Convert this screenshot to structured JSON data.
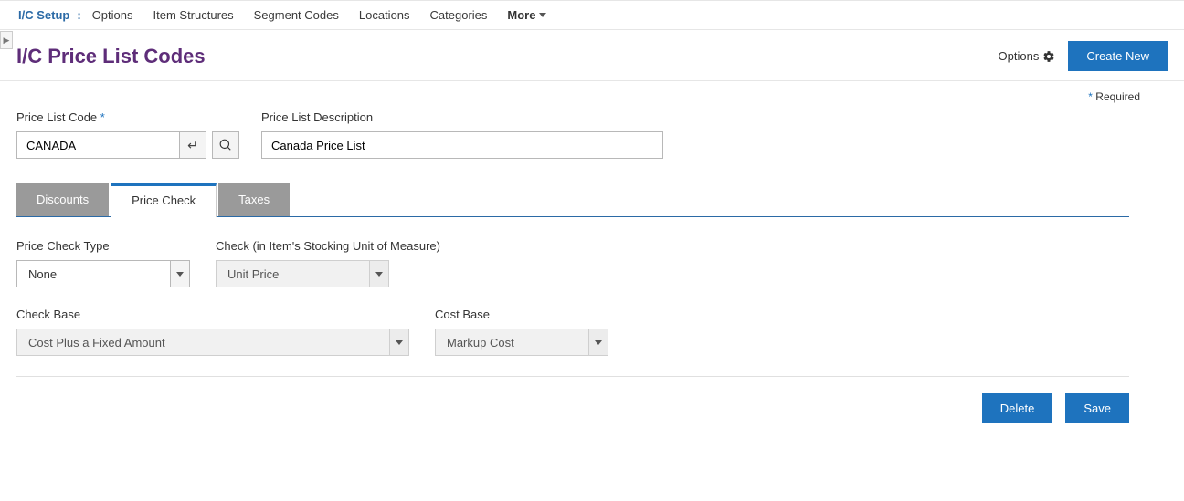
{
  "header": {
    "crumb_root": "I/C Setup",
    "nav": [
      "Options",
      "Item Structures",
      "Segment Codes",
      "Locations",
      "Categories"
    ],
    "more": "More"
  },
  "page": {
    "title": "I/C Price List Codes",
    "options_label": "Options",
    "create_btn": "Create New",
    "required_label": "Required"
  },
  "form": {
    "code_label": "Price List Code",
    "code_value": "CANADA",
    "desc_label": "Price List Description",
    "desc_value": "Canada Price List"
  },
  "tabs": [
    "Discounts",
    "Price Check",
    "Taxes"
  ],
  "panel": {
    "check_type_label": "Price Check Type",
    "check_type_value": "None",
    "check_uom_label": "Check (in Item's Stocking Unit of Measure)",
    "check_uom_value": "Unit Price",
    "check_base_label": "Check Base",
    "check_base_value": "Cost Plus a Fixed Amount",
    "cost_base_label": "Cost Base",
    "cost_base_value": "Markup Cost"
  },
  "footer": {
    "delete": "Delete",
    "save": "Save"
  }
}
